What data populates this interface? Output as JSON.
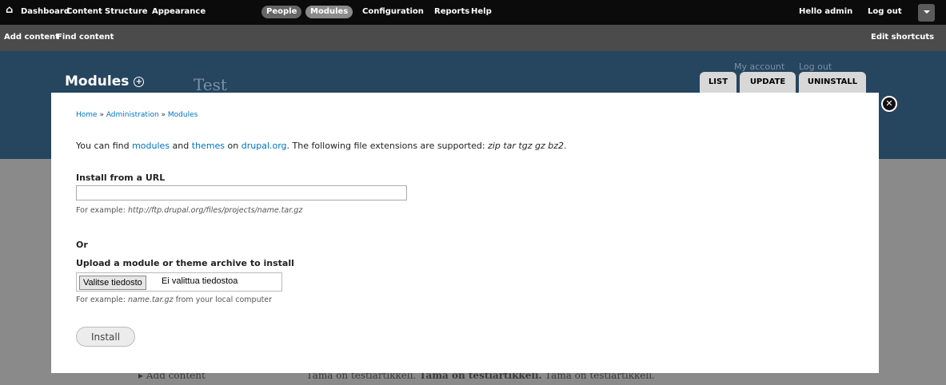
{
  "toolbar": {
    "home_icon": "home-icon",
    "items": [
      "Dashboard",
      "Content",
      "Structure",
      "Appearance",
      "People",
      "Modules",
      "Configuration",
      "Reports",
      "Help"
    ],
    "hello": "Hello",
    "user": "admin",
    "logout": "Log out"
  },
  "shortcuts": {
    "items": [
      "Add content",
      "Find content"
    ],
    "edit": "Edit shortcuts"
  },
  "header": {
    "site_name": "Test",
    "secondary": [
      "My account",
      "Log out"
    ],
    "title": "Modules",
    "tabs": [
      "LIST",
      "UPDATE",
      "UNINSTALL"
    ]
  },
  "overlay": {
    "breadcrumb": [
      "Home",
      "Administration",
      "Modules"
    ],
    "breadcrumb_sep": " » ",
    "intro": {
      "t1": "You can find ",
      "link1": "modules",
      "t2": " and ",
      "link2": "themes",
      "t3": " on ",
      "link3": "drupal.org",
      "t4": ". The following file extensions are supported: ",
      "ext": "zip tar tgz gz bz2",
      "t5": "."
    },
    "url_label": "Install from a URL",
    "url_desc_prefix": "For example: ",
    "url_example": "http://ftp.drupal.org/files/projects/name.tar.gz",
    "or": "Or",
    "upload_label": "Upload a module or theme archive to install",
    "file_button": "Valitse tiedosto",
    "file_status": "Ei valittua tiedostoa",
    "upload_desc_prefix": "For example: ",
    "upload_example": "name.tar.gz",
    "upload_desc_suffix": " from your local computer",
    "install": "Install"
  },
  "background": {
    "sidebar_link": "Add content",
    "article": [
      "Tämä on testiartikkeli.",
      "Tämä on testiartikkeli.",
      "Tämä on testiartikkeli."
    ]
  }
}
